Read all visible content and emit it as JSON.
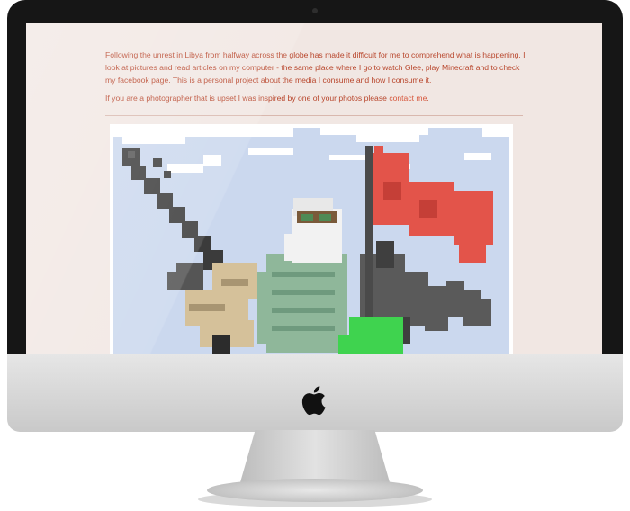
{
  "page": {
    "paragraph1": {
      "text": "Following the unrest in Libya from halfway across the globe has made it difficult for me to comprehend what is happening. I look at pictures and read articles on my computer - the same place where I go to watch Glee, play Minecraft and to check my facebook page. This is a personal project about the media I consume and how I consume it."
    },
    "paragraph2": {
      "before": "If you are a photographer that is upset I was inspired by one of your photos please ",
      "link": "contact me",
      "after": "."
    },
    "image": {
      "alt": "Pixel art of a rebel fighter with a gun and a red flag"
    }
  },
  "device": {
    "brand_icon": "apple-logo-icon",
    "screen_bg": "#f1e7e3",
    "text_color": "#b8452b",
    "link_color": "#d7573c"
  }
}
